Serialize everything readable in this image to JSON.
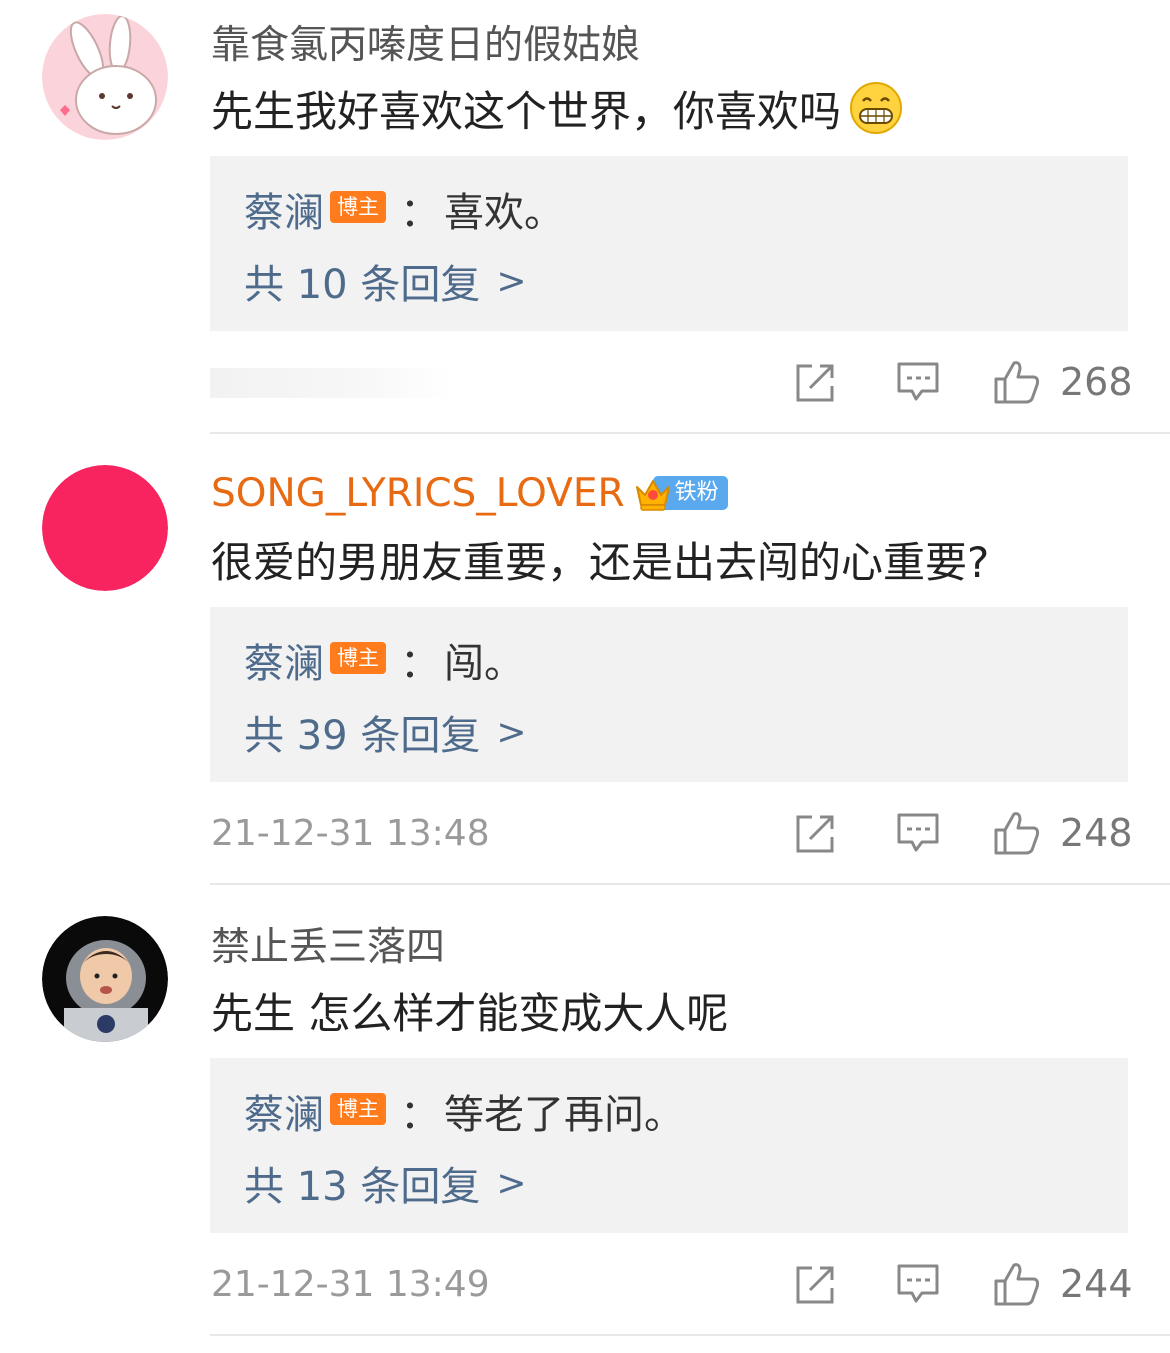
{
  "comments": [
    {
      "username": "靠食氯丙嗪度日的假姑娘",
      "vip": false,
      "text": "先生我好喜欢这个世界，你喜欢吗",
      "emoji": "grin-emoji",
      "reply": {
        "author": "蔡澜",
        "badge": "博主",
        "colon": "：",
        "text": "喜欢。",
        "count_label": "共 10 条回复",
        "chevron": ">"
      },
      "timestamp": "",
      "likes": "268"
    },
    {
      "username": "SONG_LYRICS_LOVER",
      "vip": true,
      "fan_badge": "铁粉",
      "text": "很爱的男朋友重要，还是出去闯的心重要?",
      "reply": {
        "author": "蔡澜",
        "badge": "博主",
        "colon": "：",
        "text": "闯。",
        "count_label": "共 39 条回复",
        "chevron": ">"
      },
      "timestamp": "21-12-31 13:48",
      "likes": "248"
    },
    {
      "username": "禁止丢三落四",
      "vip": false,
      "text": "先生 怎么样才能变成大人呢",
      "reply": {
        "author": "蔡澜",
        "badge": "博主",
        "colon": "：",
        "text": "等老了再问。",
        "count_label": "共 13 条回复",
        "chevron": ">"
      },
      "timestamp": "21-12-31 13:49",
      "likes": "244"
    }
  ],
  "colors": {
    "link": "#4e6b8c",
    "vip_name": "#e86a12",
    "owner_badge": "#ff7b1c",
    "fan_badge": "#5aa9ee",
    "reply_bg": "#f2f2f2",
    "meta": "#9a9a9a"
  },
  "icons": [
    "share-icon",
    "comment-icon",
    "thumbs-up-icon"
  ]
}
